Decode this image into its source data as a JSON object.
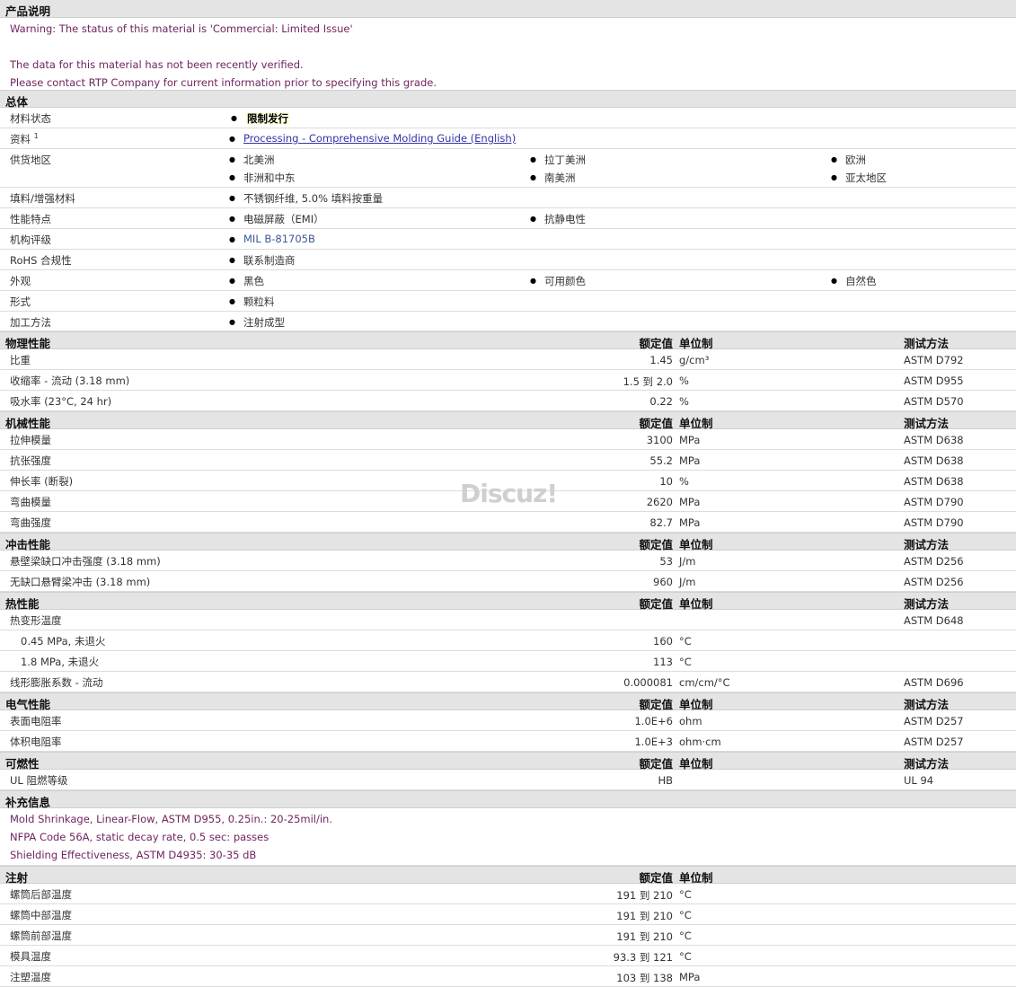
{
  "product_description": {
    "header": "产品说明",
    "lines": [
      "Warning: The status of this material is 'Commercial: Limited Issue'",
      "",
      "The data for this material has not been recently verified.",
      "Please contact RTP Company for current information prior to specifying this grade."
    ]
  },
  "general": {
    "header": "总体",
    "material_status_label": "材料状态",
    "material_status_value": "限制发行",
    "literature_label": "资料",
    "literature_sup": "1",
    "literature_link": "Processing - Comprehensive Molding Guide (English)",
    "availability_label": "供货地区",
    "availability": [
      "北美洲",
      "拉丁美洲",
      "欧洲",
      "非洲和中东",
      "南美洲",
      "亚太地区"
    ],
    "filler_label": "填料/增强材料",
    "filler_value": "不锈钢纤维, 5.0% 填料按重量",
    "features_label": "性能特点",
    "features": [
      "电磁屏蔽（EMI）",
      "抗静电性"
    ],
    "agency_label": "机构评级",
    "agency_value": "MIL B-81705B",
    "rohs_label": "RoHS 合规性",
    "rohs_value": "联系制造商",
    "appearance_label": "外观",
    "appearance": [
      "黑色",
      "可用颜色",
      "自然色"
    ],
    "form_label": "形式",
    "form_value": "颗粒料",
    "processing_label": "加工方法",
    "processing_value": "注射成型"
  },
  "col_headers": {
    "nominal": "额定值",
    "unit": "单位制",
    "method": "测试方法"
  },
  "physical": {
    "header": "物理性能",
    "rows": [
      {
        "label": "比重",
        "nominal": "1.45",
        "unit": "g/cm³",
        "method": "ASTM D792"
      },
      {
        "label": "收缩率  - 流动 (3.18 mm)",
        "nominal": "1.5 到  2.0",
        "unit": "%",
        "method": "ASTM D955"
      },
      {
        "label": "吸水率 (23°C, 24 hr)",
        "nominal": "0.22",
        "unit": "%",
        "method": "ASTM D570"
      }
    ]
  },
  "mechanical": {
    "header": "机械性能",
    "rows": [
      {
        "label": "拉伸模量",
        "nominal": "3100",
        "unit": "MPa",
        "method": "ASTM D638"
      },
      {
        "label": "抗张强度",
        "nominal": "55.2",
        "unit": "MPa",
        "method": "ASTM D638"
      },
      {
        "label": "伸长率 (断裂)",
        "nominal": "10",
        "unit": "%",
        "method": "ASTM D638"
      },
      {
        "label": "弯曲模量",
        "nominal": "2620",
        "unit": "MPa",
        "method": "ASTM D790"
      },
      {
        "label": "弯曲强度",
        "nominal": "82.7",
        "unit": "MPa",
        "method": "ASTM D790"
      }
    ]
  },
  "impact": {
    "header": "冲击性能",
    "rows": [
      {
        "label": "悬壁梁缺口冲击强度 (3.18 mm)",
        "nominal": "53",
        "unit": "J/m",
        "method": "ASTM D256"
      },
      {
        "label": "无缺口悬臂梁冲击 (3.18 mm)",
        "nominal": "960",
        "unit": "J/m",
        "method": "ASTM D256"
      }
    ]
  },
  "thermal": {
    "header": "热性能",
    "rows": [
      {
        "label": "热变形温度",
        "nominal": "",
        "unit": "",
        "method": "ASTM D648"
      },
      {
        "label": "0.45 MPa, 未退火",
        "nominal": "160",
        "unit": "°C",
        "method": ""
      },
      {
        "label": "1.8 MPa, 未退火",
        "nominal": "113",
        "unit": "°C",
        "method": ""
      },
      {
        "label": "线形膨胀系数  - 流动",
        "nominal": "0.000081",
        "unit": "cm/cm/°C",
        "method": "ASTM D696"
      }
    ]
  },
  "electrical": {
    "header": "电气性能",
    "rows": [
      {
        "label": "表面电阻率",
        "nominal": "1.0E+6",
        "unit": "ohm",
        "method": "ASTM D257"
      },
      {
        "label": "体积电阻率",
        "nominal": "1.0E+3",
        "unit": "ohm·cm",
        "method": "ASTM D257"
      }
    ]
  },
  "flammability": {
    "header": "可燃性",
    "rows": [
      {
        "label": "UL 阻燃等级",
        "nominal": "HB",
        "unit": "",
        "method": "UL 94"
      }
    ]
  },
  "supplemental": {
    "header": "补充信息",
    "lines": [
      "Mold Shrinkage, Linear-Flow, ASTM D955, 0.25in.: 20-25mil/in.",
      "NFPA Code 56A, static decay rate, 0.5 sec: passes",
      "Shielding Effectiveness, ASTM D4935: 30-35 dB"
    ]
  },
  "injection": {
    "header": "注射",
    "rows": [
      {
        "label": "螺筒后部温度",
        "nominal": "191 到  210",
        "unit": "°C"
      },
      {
        "label": "螺筒中部温度",
        "nominal": "191 到  210",
        "unit": "°C"
      },
      {
        "label": "螺筒前部温度",
        "nominal": "191 到  210",
        "unit": "°C"
      },
      {
        "label": "模具温度",
        "nominal": "93.3 到  121",
        "unit": "°C"
      },
      {
        "label": "注塑温度",
        "nominal": "103 到  138",
        "unit": "MPa"
      }
    ]
  },
  "watermark": "Discuz!"
}
